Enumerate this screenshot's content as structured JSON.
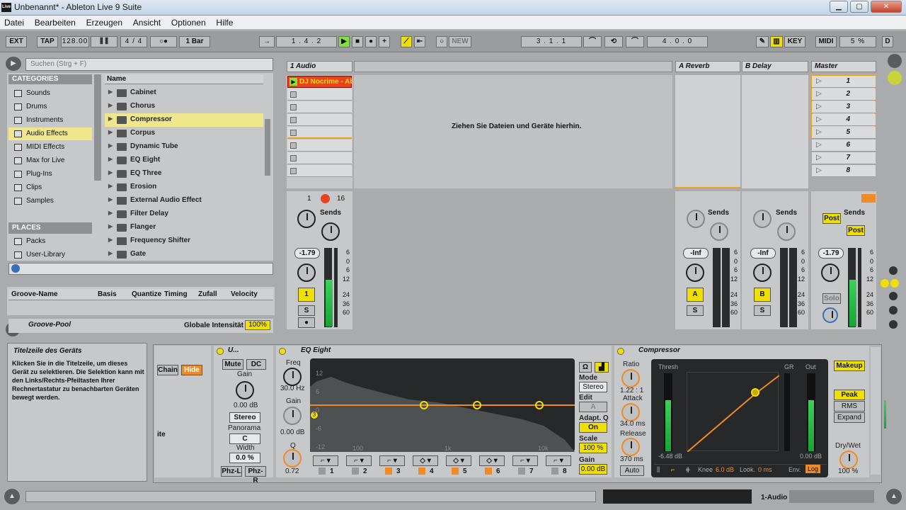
{
  "window": {
    "title": "Unbenannt* - Ableton Live 9 Suite",
    "logo": "Live"
  },
  "menu": [
    "Datei",
    "Bearbeiten",
    "Erzeugen",
    "Ansicht",
    "Optionen",
    "Hilfe"
  ],
  "transport": {
    "ext": "EXT",
    "tap": "TAP",
    "tempo": "128.00",
    "sig": "4 / 4",
    "quant": "1 Bar",
    "pos": "1 .   4 .   2",
    "new": "NEW",
    "loop_start": "3 .   1 .   1",
    "loop_len": "4 .   0 .   0",
    "key": "KEY",
    "midi": "MIDI",
    "cpu": "5 %",
    "d": "D"
  },
  "browser": {
    "search_placeholder": "Suchen (Strg + F)",
    "categories_header": "CATEGORIES",
    "categories": [
      "Sounds",
      "Drums",
      "Instruments",
      "Audio Effects",
      "MIDI Effects",
      "Max for Live",
      "Plug-Ins",
      "Clips",
      "Samples"
    ],
    "places_header": "PLACES",
    "places": [
      "Packs",
      "User-Library"
    ],
    "name_header": "Name",
    "items": [
      "Cabinet",
      "Chorus",
      "Compressor",
      "Corpus",
      "Dynamic Tube",
      "EQ Eight",
      "EQ Three",
      "Erosion",
      "External Audio Effect",
      "Filter Delay",
      "Flanger",
      "Frequency Shifter",
      "Gate"
    ]
  },
  "groove": {
    "cols": [
      "Groove-Name",
      "Basis",
      "Quantize",
      "Timing",
      "Zufall",
      "Velocity"
    ],
    "pool": "Groove-Pool",
    "intensity_label": "Globale Intensität",
    "intensity": "100%"
  },
  "session": {
    "tracks": [
      "1 Audio",
      "A Reverb",
      "B Delay",
      "Master"
    ],
    "clip": "DJ Nocrime - Ab",
    "drop": "Ziehen Sie Dateien und Geräte hierhin.",
    "scenes": [
      "1",
      "2",
      "3",
      "4",
      "5",
      "6",
      "7",
      "8"
    ],
    "in_out": "1",
    "in_out2": "16",
    "sends": "Sends",
    "post": "Post",
    "vol1": "-1.79",
    "vol_a": "-Inf",
    "vol_b": "-Inf",
    "vol_m": "-1.79",
    "track_num": "1",
    "track_a": "A",
    "track_b": "B",
    "solo": "S",
    "master_solo": "Solo",
    "scale": [
      "6",
      "0",
      "6",
      "12",
      "24",
      "36",
      "60"
    ]
  },
  "info": {
    "title": "Titelzeile des Geräts",
    "body": "Klicken Sie in die Titelzeile, um dieses Gerät zu selektieren. Die Selektion kann mit den Links/Rechts-Pfeiltasten Ihrer Rechnertastatur zu benachbarten Geräten bewegt werden."
  },
  "devices": {
    "chain": "Chain",
    "hide": "Hide",
    "ite": "ite",
    "util": {
      "title": "U...",
      "mute": "Mute",
      "dc": "DC",
      "gain": "Gain",
      "gain_val": "0.00 dB",
      "stereo": "Stereo",
      "pan": "Panorama",
      "pan_val": "C",
      "width": "Width",
      "width_val": "0.0 %",
      "phz_l": "Phz-L",
      "phz_r": "Phz-R"
    },
    "eq": {
      "title": "EQ Eight",
      "freq": "Freq",
      "freq_val": "30.0 Hz",
      "gain": "Gain",
      "gain_val": "0.00 dB",
      "q": "Q",
      "q_val": "0.72",
      "mode": "Mode",
      "mode_val": "Stereo",
      "edit": "Edit",
      "edit_val": "A",
      "adapt": "Adapt. Q",
      "adapt_val": "On",
      "scale": "Scale",
      "scale_val": "100 %",
      "gain2": "Gain",
      "gain2_val": "0.00 dB",
      "grid": [
        "12",
        "6",
        "0",
        "-6",
        "-12"
      ],
      "freqs": [
        "100",
        "1k",
        "10k"
      ],
      "bands": [
        "1",
        "2",
        "3",
        "4",
        "5",
        "6",
        "7",
        "8"
      ]
    },
    "comp": {
      "title": "Compressor",
      "ratio": "Ratio",
      "ratio_val": "1.22 : 1",
      "attack": "Attack",
      "attack_val": "34.0 ms",
      "release": "Release",
      "release_val": "370 ms",
      "auto": "Auto",
      "thresh": "Thresh",
      "gr": "GR",
      "out": "Out",
      "thresh_val": "-6.48 dB",
      "out_val": "0.00 dB",
      "makeup": "Makeup",
      "peak": "Peak",
      "rms": "RMS",
      "expand": "Expand",
      "drywet": "Dry/Wet",
      "drywet_val": "100 %",
      "knee": "Knee",
      "knee_val": "6.0 dB",
      "look": "Look.",
      "look_val": "0 ms",
      "env": "Env.",
      "env_val": "Log"
    }
  },
  "status": {
    "track": "1-Audio"
  },
  "colors": {
    "accent": "#f0e000",
    "orange": "#f08a24",
    "selected": "#f0e68c"
  }
}
